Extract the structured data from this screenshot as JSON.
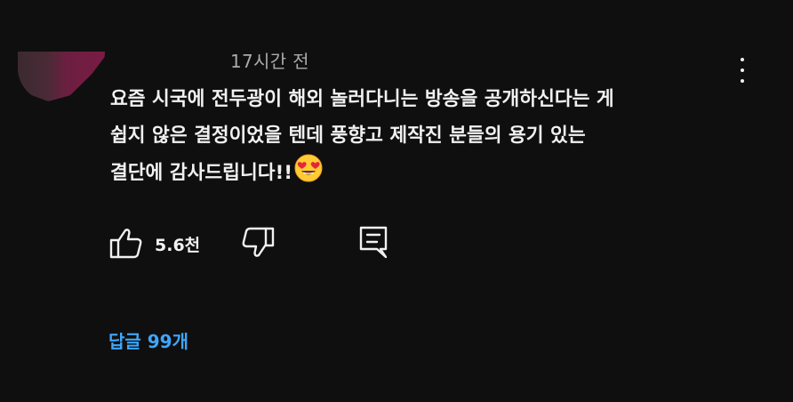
{
  "comment": {
    "timestamp": "17시간 전",
    "text_lines": [
      "요즘 시국에 전두광이 해외 놀러다니는 방송을 공개하신다는 게",
      "쉽지 않은 결정이었을 텐데 풍향고 제작진 분들의 용기 있는",
      "결단에 감사드립니다!!"
    ],
    "emoji": "heart-eyes-emoji",
    "like_count": "5.6천",
    "replies_label": "답글 99개"
  },
  "icons": {
    "more": "more-vertical-icon",
    "like": "thumbs-up-icon",
    "dislike": "thumbs-down-icon",
    "reply": "comment-reply-icon"
  },
  "colors": {
    "background": "#0f0f0f",
    "text": "#f1f1f1",
    "secondary_text": "#aaaaaa",
    "link": "#3ea6ff"
  }
}
